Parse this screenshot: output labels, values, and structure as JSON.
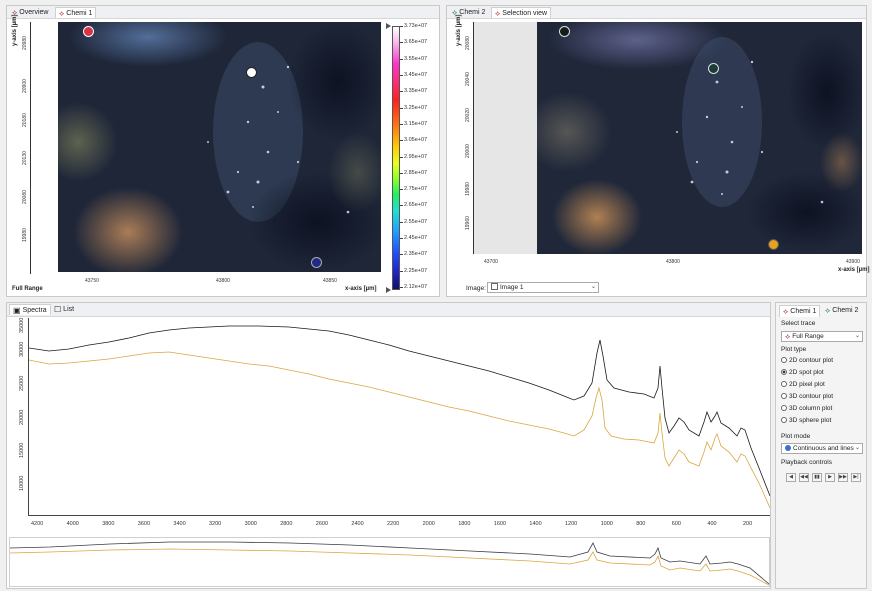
{
  "left_view": {
    "tabs": [
      {
        "label": "Overview"
      },
      {
        "label": "Chemi 1"
      }
    ],
    "y_axis_title": "y-axis [µm]",
    "y_ticks": [
      "20980",
      "20900",
      "20180",
      "20130",
      "20080",
      "19980"
    ],
    "x_ticks": [
      "43750",
      "43800",
      "43850"
    ],
    "x_axis_title": "x-axis [µm]",
    "full_range_label": "Full Range",
    "colorbar_labels": [
      "3.73e+07",
      "3.65e+07",
      "3.55e+07",
      "3.45e+07",
      "3.35e+07",
      "3.25e+07",
      "3.15e+07",
      "3.05e+07",
      "2.95e+07",
      "2.85e+07",
      "2.75e+07",
      "2.65e+07",
      "2.55e+07",
      "2.45e+07",
      "2.35e+07",
      "2.25e+07",
      "2.12e+07"
    ]
  },
  "right_view": {
    "tabs": [
      {
        "label": "Chemi 2"
      },
      {
        "label": "Selection view"
      }
    ],
    "y_axis_title": "y-axis [µm]",
    "y_ticks": [
      "20080",
      "20040",
      "20020",
      "20000",
      "19980",
      "19960"
    ],
    "x_ticks": [
      "43700",
      "43800",
      "43900"
    ],
    "x_axis_title": "x-axis [µm]",
    "image_label": "Image:",
    "image_select": "Image 1"
  },
  "spectra": {
    "tabs": [
      {
        "label": "Spectra"
      },
      {
        "label": "List"
      }
    ],
    "y_ticks": [
      "35000",
      "30000",
      "25000",
      "20000",
      "15000",
      "10000"
    ],
    "x_ticks": [
      "4200",
      "4000",
      "3800",
      "3600",
      "3400",
      "3200",
      "3000",
      "2800",
      "2600",
      "2400",
      "2200",
      "2000",
      "1800",
      "1600",
      "1400",
      "1200",
      "1000",
      "800",
      "600",
      "400",
      "200"
    ]
  },
  "right_panel": {
    "tabs": [
      {
        "label": "Chemi 1"
      },
      {
        "label": "Chemi 2"
      }
    ],
    "select_trace_title": "Select trace",
    "trace_value": "Full Range",
    "plot_type_title": "Plot type",
    "plot_types": [
      {
        "label": "2D contour plot",
        "selected": false
      },
      {
        "label": "2D spot plot",
        "selected": true
      },
      {
        "label": "2D pixel plot",
        "selected": false
      },
      {
        "label": "3D contour plot",
        "selected": false
      },
      {
        "label": "3D column plot",
        "selected": false
      },
      {
        "label": "3D sphere plot",
        "selected": false
      }
    ],
    "plot_mode_title": "Plot mode",
    "plot_mode_value": "Continuous and lines",
    "playback_title": "Playback controls",
    "playback_buttons": [
      "◀",
      "◀◀",
      "▮▮",
      "▶",
      "▶▶",
      "▶|"
    ]
  },
  "colors": {
    "trace_black": "#1a1a1a",
    "trace_gold": "#d8a640",
    "marker_red": "#d9334a",
    "marker_navy": "#1f2a86",
    "marker_gold": "#e9a21f"
  }
}
